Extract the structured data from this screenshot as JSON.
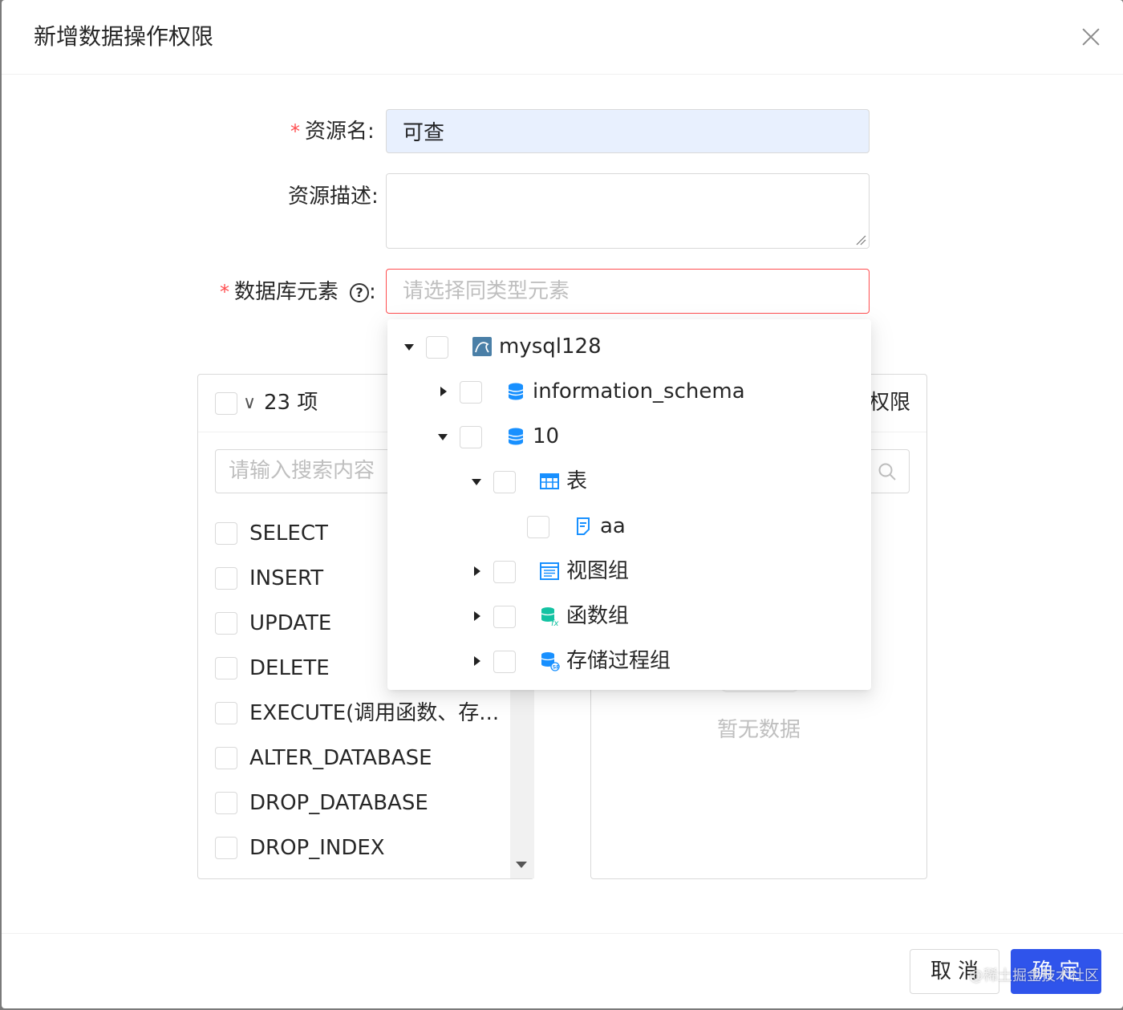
{
  "modal": {
    "title": "新增数据操作权限"
  },
  "form": {
    "required_mark": "*",
    "name_label": "资源名:",
    "name_value": "可查",
    "desc_label": "资源描述:",
    "db_label": "数据库元素",
    "help_glyph": "?",
    "colon": ":",
    "db_placeholder": "请选择同类型元素"
  },
  "transfer": {
    "left": {
      "count": "23 项",
      "search_placeholder": "请输入搜索内容",
      "items": [
        "SELECT",
        "INSERT",
        "UPDATE",
        "DELETE",
        "EXECUTE(调用函数、存...",
        "ALTER_DATABASE",
        "DROP_DATABASE",
        "DROP_INDEX"
      ]
    },
    "right": {
      "title": "权限",
      "empty_text": "暂无数据"
    }
  },
  "tree": {
    "nodes": [
      {
        "label": "mysql128",
        "icon": "mysql-icon"
      },
      {
        "label": "information_schema",
        "icon": "database-icon"
      },
      {
        "label": "10",
        "icon": "database-icon"
      },
      {
        "label": "表",
        "icon": "table-icon"
      },
      {
        "label": "aa",
        "icon": "table-file-icon"
      },
      {
        "label": "视图组",
        "icon": "view-icon"
      },
      {
        "label": "函数组",
        "icon": "function-icon"
      },
      {
        "label": "存储过程组",
        "icon": "procedure-icon"
      }
    ]
  },
  "footer": {
    "cancel_label": "取消",
    "ok_label": "确定",
    "watermark": "@稀土掘金技术社区"
  },
  "colors": {
    "primary": "#2f54eb",
    "error": "#ff4d4f",
    "autofill_bg": "#e8f0fe",
    "icon_blue": "#1890ff"
  }
}
